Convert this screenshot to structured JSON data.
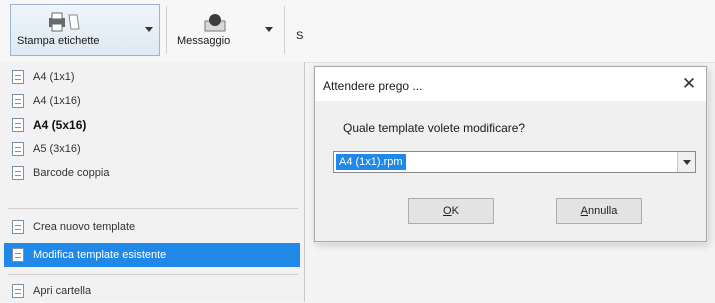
{
  "ribbon": {
    "print_labels_button": {
      "label": "Stampa etichette",
      "icon": "printer-icon"
    },
    "message_button": {
      "label": "Messaggio",
      "icon": "message-icon"
    },
    "truncated_label": "S"
  },
  "menu": {
    "items": [
      {
        "label": "A4 (1x1)",
        "icon": "template-icon",
        "bold": false,
        "highlighted": false
      },
      {
        "label": "A4 (1x16)",
        "icon": "template-icon",
        "bold": false,
        "highlighted": false
      },
      {
        "label": "A4 (5x16)",
        "icon": "template-icon",
        "bold": true,
        "highlighted": false
      },
      {
        "label": "A5 (3x16)",
        "icon": "template-icon",
        "bold": false,
        "highlighted": false
      },
      {
        "label": "Barcode coppia",
        "icon": "template-icon",
        "bold": false,
        "highlighted": false
      },
      {
        "label": "Crea nuovo template",
        "icon": "template-icon",
        "bold": false,
        "highlighted": false
      },
      {
        "label": "Modifica template esistente",
        "icon": "template-icon",
        "bold": false,
        "highlighted": true
      },
      {
        "label": "Apri cartella",
        "icon": "template-icon",
        "bold": false,
        "highlighted": false
      }
    ],
    "highlight_color": "#1f88e8"
  },
  "dialog": {
    "title": "Attendere prego ...",
    "close_icon": "close-icon",
    "prompt": "Quale template volete modificare?",
    "combo_value": "A4 (1x1).rpm",
    "ok_label": "OK",
    "ok_mnemonic": "O",
    "ok_rest": "K",
    "cancel_label": "Annulla",
    "cancel_mnemonic": "A",
    "cancel_rest": "nnulla"
  }
}
